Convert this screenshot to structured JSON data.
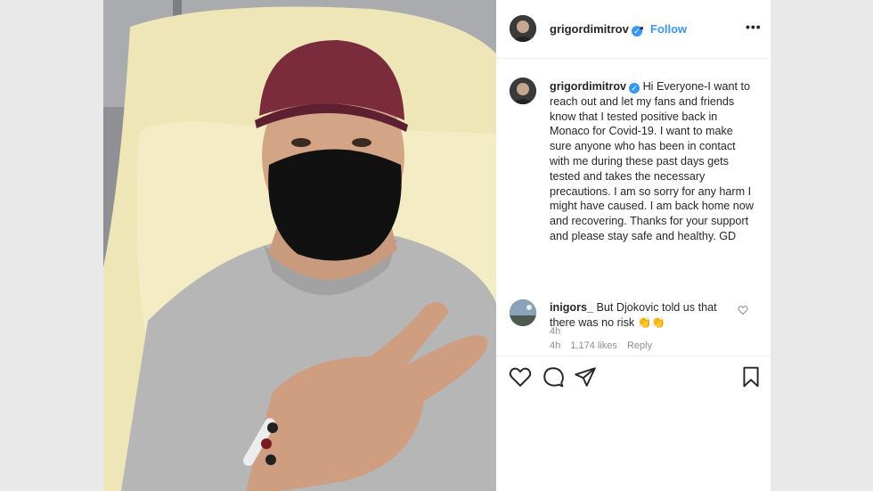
{
  "post": {
    "username": "grigordimitrov",
    "verified_mark": "✓",
    "separator": "•",
    "follow_label": "Follow",
    "more_label": "•••"
  },
  "caption": {
    "username": "grigordimitrov",
    "text": "Hi Everyone-I want to reach out and let my fans and friends know that I tested positive back in Monaco for Covid-19. I want to make sure anyone who has been in contact with me during these past days gets tested and takes the necessary precautions. I am so sorry for any harm I might have caused. I am back home now and recovering. Thanks for your support and please stay safe and healthy. GD",
    "time": "4h"
  },
  "comment": {
    "username": "inigors_",
    "text": "But Djokovic told us that there was no risk 👏👏",
    "time": "4h",
    "likes": "1,174 likes",
    "reply_label": "Reply"
  },
  "icons": {
    "like": "heart-icon",
    "comment": "comment-bubble-icon",
    "share": "paper-plane-icon",
    "save": "bookmark-icon",
    "comment_like": "small-heart-icon"
  },
  "colors": {
    "link_blue": "#3897f0",
    "text": "#262626",
    "muted": "#8e8e8e",
    "background": "#e9e9e9"
  }
}
